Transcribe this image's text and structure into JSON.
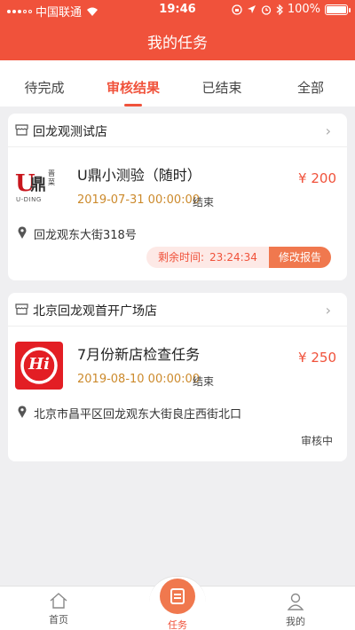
{
  "status_bar": {
    "carrier": "中国联通",
    "time": "19:46",
    "battery": "100%",
    "battery_level": 1.0
  },
  "header": {
    "title": "我的任务"
  },
  "tabs": [
    {
      "label": "待完成",
      "active": false
    },
    {
      "label": "审核结果",
      "active": true
    },
    {
      "label": "已结束",
      "active": false
    },
    {
      "label": "全部",
      "active": false
    }
  ],
  "cards": [
    {
      "store": "回龙观测试店",
      "logo": {
        "top": "鼎",
        "letter": "U",
        "side": "晋菜",
        "caption": "U-DING"
      },
      "title": "U鼎小测验（随时）",
      "date": "2019-07-31 00:00:00",
      "date_status": "结束",
      "price": "¥ 200",
      "address": "回龙观东大街318号",
      "remaining_label": "剩余时间:",
      "remaining_time": "23:24:34",
      "action": "修改报告"
    },
    {
      "store": "北京回龙观首开广场店",
      "logo": {
        "text": "Hi"
      },
      "title": "7月份新店检查任务",
      "date": "2019-08-10 00:00:00",
      "date_status": "结束",
      "price": "¥ 250",
      "address": "北京市昌平区回龙观东大街良庄西街北口",
      "status": "审核中"
    }
  ],
  "bottom_nav": [
    {
      "label": "首页",
      "icon": "home-icon"
    },
    {
      "label": "任务",
      "icon": "task-icon",
      "active": true
    },
    {
      "label": "我的",
      "icon": "user-icon"
    }
  ],
  "colors": {
    "accent": "#f0523b",
    "date": "#cc8a2c",
    "background": "#efeff1"
  }
}
